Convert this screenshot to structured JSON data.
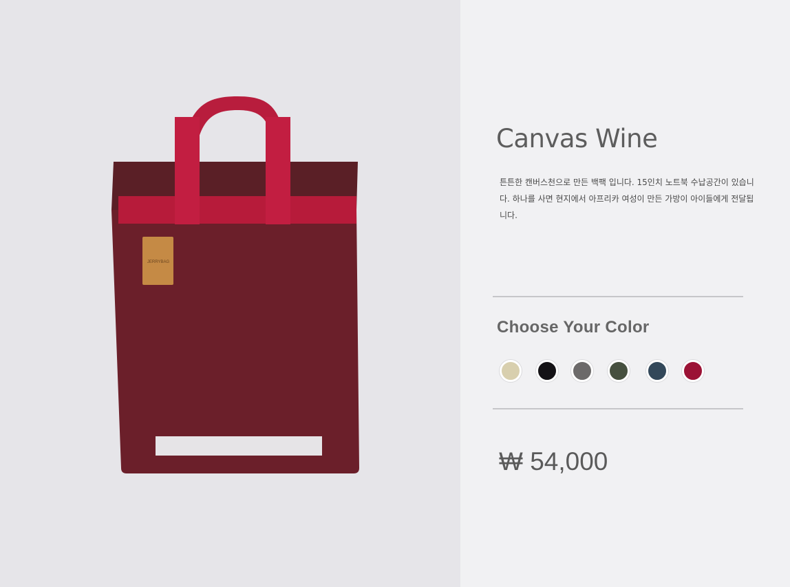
{
  "product": {
    "title": "Canvas Wine",
    "description": "튼튼한 캔버스천으로 만든 백팩 입니다. 15인치 노트북 수납공간이 있습니다. 하나를 사면 현지에서 아프리카 여성이 만든 가방이 아이들에게 전달됩니다.",
    "price": "₩ 54,000",
    "image_alt": "JERRYBAG"
  },
  "colors": {
    "heading": "Choose Your Color",
    "options": [
      {
        "name": "beige",
        "hex": "#d8cfae"
      },
      {
        "name": "black",
        "hex": "#141216"
      },
      {
        "name": "gray",
        "hex": "#6c6a6a"
      },
      {
        "name": "olive",
        "hex": "#46503f"
      },
      {
        "name": "navy",
        "hex": "#33485a"
      },
      {
        "name": "wine",
        "hex": "#9b1235"
      }
    ]
  }
}
